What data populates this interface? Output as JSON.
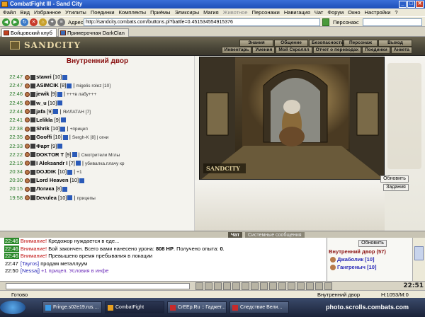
{
  "window": {
    "title": "CombatFight III - Sand City"
  },
  "menu": [
    "Файл",
    "Вид",
    "Избранное",
    "Утилиты",
    "Поединки",
    "Комплекты",
    "Приёмы",
    "Эликсиры",
    "Магия",
    "Животное",
    "Персонажи",
    "Навигация",
    "Чат",
    "Форум",
    "Окно",
    "Настройки",
    "?"
  ],
  "address": {
    "label": "Адрес:",
    "url": "http://sandcity.combats.com/buttons.pl?battle=0.451534554915376",
    "char_label": "Персонаж:"
  },
  "tabs": [
    "Бойцовский клуб",
    "Примерочная DarkClan"
  ],
  "game": {
    "logo": "SANDCITY",
    "nav_row1": [
      "Знания",
      "Общение",
      "Безопасность",
      "Персонаж",
      "Выход"
    ],
    "nav_row2": [
      "Инвентарь",
      "Умения",
      "Мой Скроллл",
      "Отчет о переводах",
      "Поединки",
      "Анкета"
    ],
    "location_title": "Внутренний двор",
    "scene_label": "SANDCITY",
    "buttons": {
      "refresh": "Обновить",
      "quests": "Задания"
    }
  },
  "online": [
    {
      "time": "22:47",
      "name": "stawri",
      "level": "[10]",
      "note": ""
    },
    {
      "time": "22:47",
      "name": "ASIMCIK",
      "level": "[8]",
      "note": "migelis rolez [10]"
    },
    {
      "time": "22:46",
      "name": "jewik",
      "level": "[9]",
      "note": "+++в лабу+++"
    },
    {
      "time": "22:45",
      "name": "w_u",
      "level": "[10]",
      "note": ""
    },
    {
      "time": "22:44",
      "name": "jafa",
      "level": "[9]",
      "note": "ЯИЛАТАН [7]"
    },
    {
      "time": "22:41",
      "name": "Lelikla",
      "level": "[9]",
      "note": ""
    },
    {
      "time": "22:38",
      "name": "Shrik",
      "level": "[10]",
      "note": "+прицеп"
    },
    {
      "time": "22:35",
      "name": "Gooffi",
      "level": "[10]",
      "note": "Sergh-K [8] | огни"
    },
    {
      "time": "22:33",
      "name": "Фарт",
      "level": "[9]",
      "note": ""
    },
    {
      "time": "22:22",
      "name": "DOKTOR T",
      "level": "[9]",
      "note": "Смотрители Мглы"
    },
    {
      "time": "22:19",
      "name": "I Aleksandr I",
      "level": "[7]",
      "note": "убивалка.плачу кр"
    },
    {
      "time": "20:34",
      "name": "DOJDIK",
      "level": "[10]",
      "note": "+1"
    },
    {
      "time": "20:30",
      "name": "Lord Heaven",
      "level": "[10]",
      "note": ""
    },
    {
      "time": "20:15",
      "name": "Логика",
      "level": "[8]",
      "note": ""
    },
    {
      "time": "19:58",
      "name": "Devulea",
      "level": "[10]",
      "note": "прицепы"
    }
  ],
  "chat": {
    "tab_chat": "Чат",
    "tab_system": "Системные сообщения",
    "lines": [
      {
        "time": "22:46",
        "kind": "warn",
        "prefix": "Внимание!",
        "text": " Кредожор нуждается в еде..."
      },
      {
        "time": "22:46",
        "kind": "warn",
        "prefix": "Внимание!",
        "text": " Бой закончен. Всего вами нанесено урона: ",
        "bold1": "808 HP",
        "mid": ". Получено опыта: ",
        "bold2": "0",
        "tail": "."
      },
      {
        "time": "22:46",
        "kind": "warn",
        "prefix": "Внимание!",
        "text": " Превышено время пребывания в локации"
      },
      {
        "time": "22:47",
        "kind": "nick",
        "prefix": "[Tayros]",
        "text": " продам металлуум"
      },
      {
        "time": "22:50",
        "kind": "priv",
        "prefix": "[Nessaj]",
        "text": " +1 прицеп. Условия в инфе"
      }
    ]
  },
  "location_panel": {
    "refresh": "Обновить",
    "title": "Внутренний двор (57)",
    "players": [
      "Джаболик [10]",
      "Гангреныч [10]"
    ]
  },
  "clock": "22:51",
  "status": {
    "text": "Готово",
    "location": "Внутренний двор",
    "hp": "H:1053/M:0"
  },
  "taskbar": {
    "items": [
      "Fringe.s02e19.rus....",
      "CombatFight",
      "CrEEp.Ru :: Гаджет...",
      "Следствие Вели..."
    ],
    "watermark": "photo.scrolls.combats.com"
  }
}
